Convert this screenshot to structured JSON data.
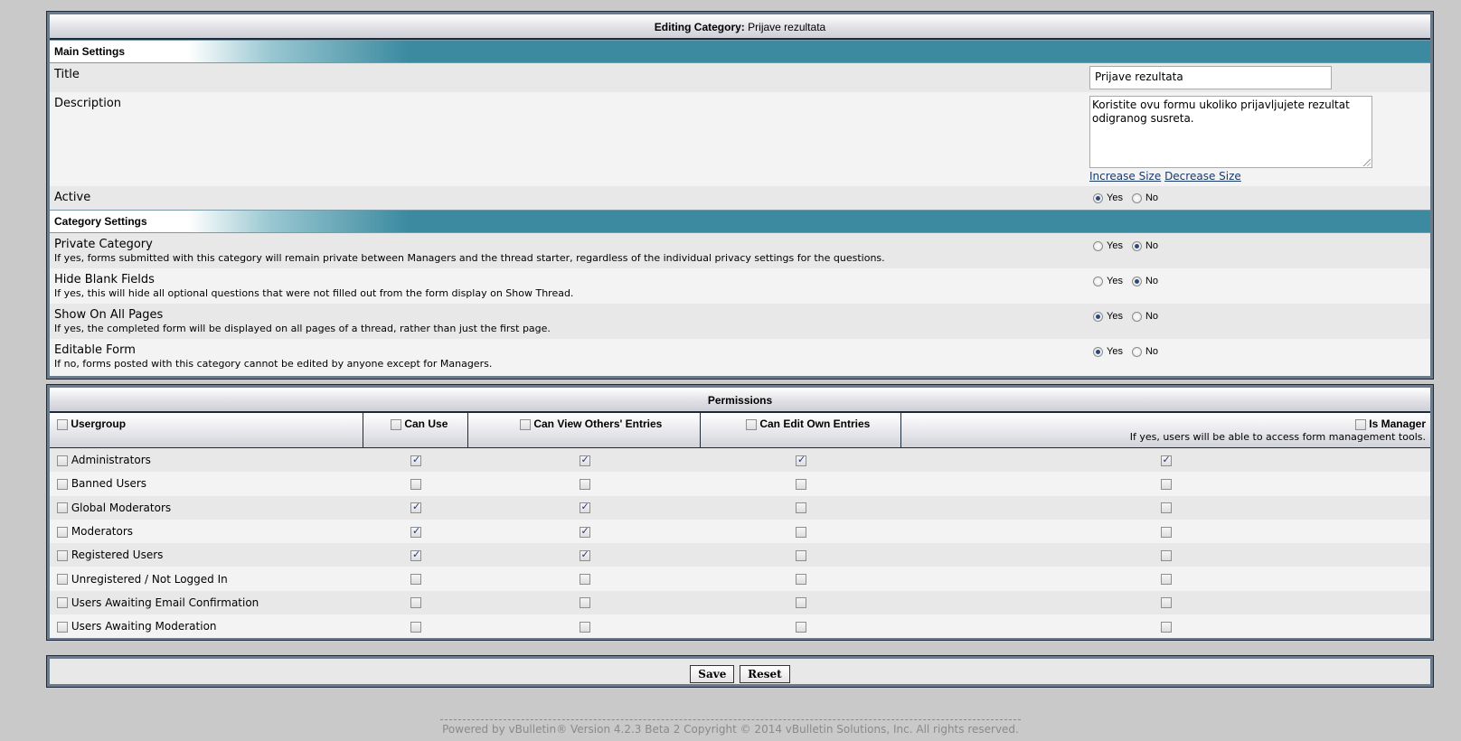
{
  "editing": {
    "header_prefix": "Editing Category:",
    "header_value": "Prijave rezultata"
  },
  "main_settings": {
    "heading": "Main Settings",
    "title_label": "Title",
    "title_value": "Prijave rezultata",
    "description_label": "Description",
    "description_value": "Koristite ovu formu ukoliko prijavljujete rezultat odigranog susreta.",
    "increase_size": "Increase Size",
    "decrease_size": "Decrease Size",
    "active_label": "Active",
    "active_value": "Yes"
  },
  "category_settings": {
    "heading": "Category Settings",
    "yes_label": "Yes",
    "no_label": "No",
    "items": [
      {
        "label": "Private Category",
        "desc": "If yes, forms submitted with this category will remain private between Managers and the thread starter, regardless of the individual privacy settings for the questions.",
        "value": "No"
      },
      {
        "label": "Hide Blank Fields",
        "desc": "If yes, this will hide all optional questions that were not filled out from the form display on Show Thread.",
        "value": "No"
      },
      {
        "label": "Show On All Pages",
        "desc": "If yes, the completed form will be displayed on all pages of a thread, rather than just the first page.",
        "value": "Yes"
      },
      {
        "label": "Editable Form",
        "desc": "If no, forms posted with this category cannot be edited by anyone except for Managers.",
        "value": "Yes"
      }
    ]
  },
  "permissions": {
    "heading": "Permissions",
    "columns": {
      "usergroup": "Usergroup",
      "can_use": "Can Use",
      "can_view": "Can View Others' Entries",
      "can_edit": "Can Edit Own Entries",
      "is_manager": "Is Manager",
      "is_manager_desc": "If yes, users will be able to access form management tools."
    },
    "rows": [
      {
        "name": "Administrators",
        "can_use": true,
        "can_view": true,
        "can_edit": true,
        "is_manager": true
      },
      {
        "name": "Banned Users",
        "can_use": false,
        "can_view": false,
        "can_edit": false,
        "is_manager": false
      },
      {
        "name": "Global Moderators",
        "can_use": true,
        "can_view": true,
        "can_edit": false,
        "is_manager": false
      },
      {
        "name": "Moderators",
        "can_use": true,
        "can_view": true,
        "can_edit": false,
        "is_manager": false
      },
      {
        "name": "Registered Users",
        "can_use": true,
        "can_view": true,
        "can_edit": false,
        "is_manager": false
      },
      {
        "name": "Unregistered / Not Logged In",
        "can_use": false,
        "can_view": false,
        "can_edit": false,
        "is_manager": false
      },
      {
        "name": "Users Awaiting Email Confirmation",
        "can_use": false,
        "can_view": false,
        "can_edit": false,
        "is_manager": false
      },
      {
        "name": "Users Awaiting Moderation",
        "can_use": false,
        "can_view": false,
        "can_edit": false,
        "is_manager": false
      }
    ]
  },
  "buttons": {
    "save": "Save",
    "reset": "Reset"
  },
  "footer": {
    "text": "Powered by vBulletin® Version 4.2.3 Beta 2 Copyright © 2014 vBulletin Solutions, Inc. All rights reserved."
  }
}
